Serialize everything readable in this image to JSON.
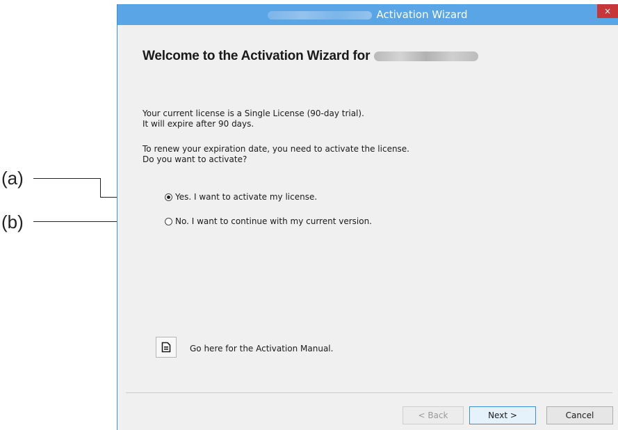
{
  "callouts": [
    {
      "label": "(a)"
    },
    {
      "label": "(b)"
    }
  ],
  "window": {
    "title": "Activation Wizard",
    "close_glyph": "×",
    "accent_color": "#5aa5e5"
  },
  "content": {
    "heading": "Welcome to the Activation Wizard for",
    "license_lines": [
      "Your current license is a Single License (90-day trial).",
      "It will expire after 90 days."
    ],
    "renew_lines": [
      "To renew your expiration date, you need to activate the license.",
      "Do you want to activate?"
    ],
    "options": [
      {
        "label": "Yes. I want to activate my license.",
        "selected": true
      },
      {
        "label": "No. I want to continue with my current version.",
        "selected": false
      }
    ],
    "manual_icon": "document-icon",
    "manual_link": "Go here for the Activation Manual."
  },
  "footer": {
    "back_label": "< Back",
    "next_label": "Next >",
    "cancel_label": "Cancel"
  }
}
